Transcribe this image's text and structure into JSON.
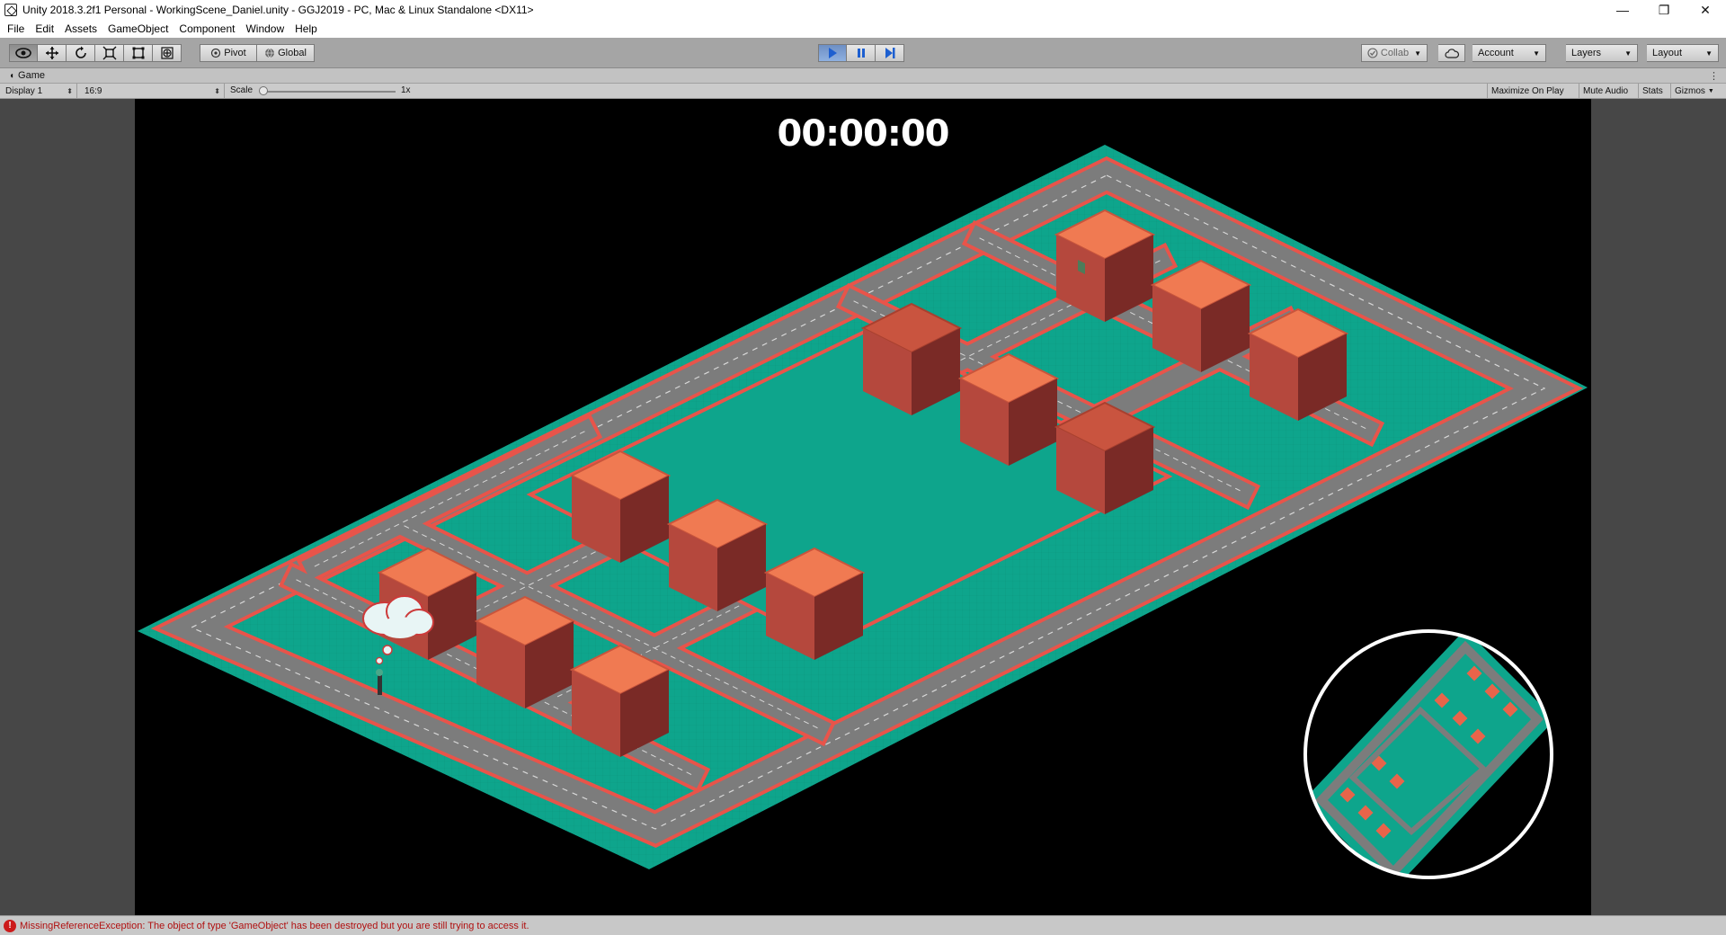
{
  "window": {
    "title": "Unity 2018.3.2f1 Personal - WorkingScene_Daniel.unity - GGJ2019 - PC, Mac & Linux Standalone <DX11>",
    "controls": {
      "minimize": "—",
      "restore": "❐",
      "close": "✕"
    }
  },
  "menu": {
    "items": [
      "File",
      "Edit",
      "Assets",
      "GameObject",
      "Component",
      "Window",
      "Help"
    ]
  },
  "toolbar": {
    "tools": [
      "hand-tool",
      "move-tool",
      "rotate-tool",
      "scale-tool",
      "rect-tool",
      "transform-tool"
    ],
    "pivot_label": "Pivot",
    "global_label": "Global",
    "collab_label": "Collab",
    "account_label": "Account",
    "layers_label": "Layers",
    "layout_label": "Layout",
    "play_state": "playing"
  },
  "game_panel": {
    "tab_label": "Game",
    "display_label": "Display 1",
    "aspect_label": "16:9",
    "scale_label": "Scale",
    "scale_value": "1x",
    "maximize_label": "Maximize On Play",
    "mute_label": "Mute Audio",
    "stats_label": "Stats",
    "gizmos_label": "Gizmos"
  },
  "game": {
    "timer": "00:00:00",
    "colors": {
      "ground": "#0ea58c",
      "road": "#7c7c7c",
      "curb": "#e8544a",
      "building_top": "#f07a52",
      "building_left": "#b5483d",
      "building_right": "#7a2a26"
    }
  },
  "status": {
    "message": "MissingReferenceException: The object of type 'GameObject' has been destroyed but you are still trying to access it."
  }
}
